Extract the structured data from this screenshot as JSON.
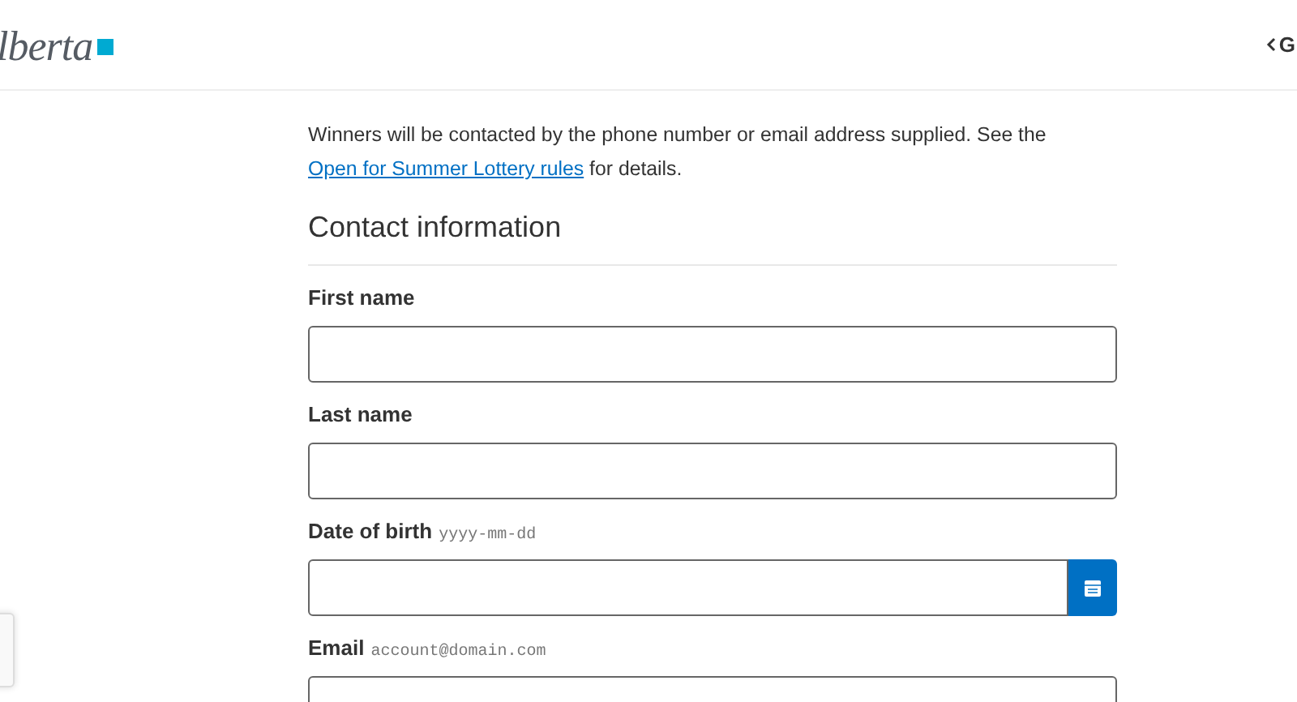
{
  "header": {
    "logo": "lberta",
    "back_link": "G"
  },
  "intro": {
    "text": "Winners will be contacted by the phone number or email address supplied. See the ",
    "link": "Open for Summer Lottery rules",
    "after": " for details."
  },
  "section_title": "Contact information",
  "fields": [
    {
      "kind": "text",
      "label": "First name"
    },
    {
      "kind": "text",
      "label": "Last name"
    },
    {
      "kind": "date",
      "label": "Date of birth",
      "hint": "yyyy-mm-dd"
    },
    {
      "kind": "text",
      "label": "Email",
      "hint": "account@domain.com"
    }
  ]
}
